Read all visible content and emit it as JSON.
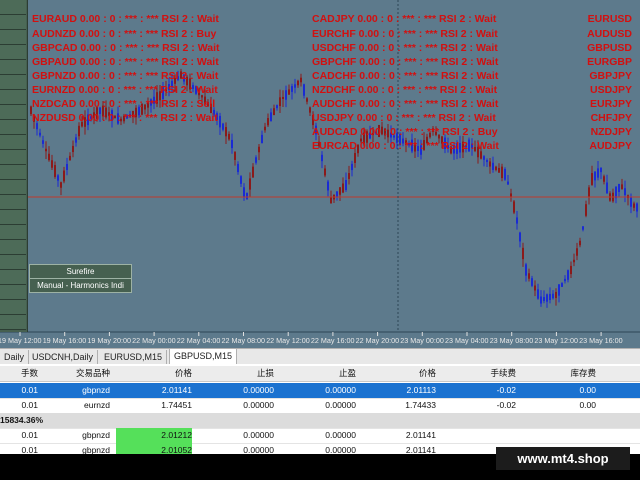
{
  "chart": {
    "bg_color": "#5d7a8c",
    "level_line_color": "#c0392b",
    "bull_color": "#1a2bd4",
    "bear_color": "#8b1a1a",
    "time_labels": [
      "19 May 12:00",
      "19 May 16:00",
      "19 May 20:00",
      "22 May 00:00",
      "22 May 04:00",
      "22 May 08:00",
      "22 May 12:00",
      "22 May 16:00",
      "22 May 20:00",
      "23 May 00:00",
      "23 May 04:00",
      "23 May 08:00",
      "23 May 12:00",
      "23 May 16:00"
    ]
  },
  "signals_left": [
    {
      "pair": "EURAUD",
      "text": "EURAUD  0.00 : 0 : *** : *** RSI 2 : Wait"
    },
    {
      "pair": "AUDNZD",
      "text": "AUDNZD  0.00 : 0 : *** : *** RSI 2 : Buy"
    },
    {
      "pair": "GBPCAD",
      "text": "GBPCAD  0.00 : 0 : *** : *** RSI 2 : Wait"
    },
    {
      "pair": "GBPAUD",
      "text": "GBPAUD  0.00 : 0 : *** : *** RSI 2 : Wait"
    },
    {
      "pair": "GBPNZD",
      "text": "GBPNZD  0.00 : 0 : *** : *** RSI 2 : Wait"
    },
    {
      "pair": "EURNZD",
      "text": "EURNZD  0.00 : 0 : *** : *** RSI 2 : Wait"
    },
    {
      "pair": "NZDCAD",
      "text": "NZDCAD  0.00 : 0 : *** : *** RSI 2 : Sell"
    },
    {
      "pair": "NZDUSD",
      "text": "NZDUSD  0.00 : 0 : *** : *** RSI 2 : Wait"
    }
  ],
  "signals_mid": [
    {
      "pair": "CADJPY",
      "text": "CADJPY  0.00 : 0 : *** : *** RSI 2 : Wait"
    },
    {
      "pair": "EURCHF",
      "text": "EURCHF  0.00 : 0 : *** : *** RSI 2 : Wait"
    },
    {
      "pair": "USDCHF",
      "text": "USDCHF  0.00 : 0 : *** : *** RSI 2 : Wait"
    },
    {
      "pair": "GBPCHF",
      "text": "GBPCHF  0.00 : 0 : *** : *** RSI 2 : Wait"
    },
    {
      "pair": "CADCHF",
      "text": "CADCHF  0.00 : 0 : *** : *** RSI 2 : Wait"
    },
    {
      "pair": "NZDCHF",
      "text": "NZDCHF  0.00 : 0 : *** : *** RSI 2 : Wait"
    },
    {
      "pair": "AUDCHF",
      "text": "AUDCHF  0.00 : 0 : *** : *** RSI 2 : Wait"
    },
    {
      "pair": "USDJPY",
      "text": "USDJPY  0.00 : 0 : *** : *** RSI 2 : Wait"
    },
    {
      "pair": "AUDCAD",
      "text": "AUDCAD  0.00 : 0 : *** : *** RSI 2 : Buy"
    },
    {
      "pair": "EURCAD",
      "text": "EURCAD  0.00 : 0 : *** : *** RSI 2 : Wait"
    }
  ],
  "signals_right": [
    "EURUSD",
    "AUDUSD",
    "GBPUSD",
    "EURGBP",
    "GBPJPY",
    "USDJPY",
    "EURJPY",
    "CHFJPY",
    "NZDJPY",
    "AUDJPY"
  ],
  "ea_buttons": [
    "Surefire",
    "Manual - Harmonics Indi"
  ],
  "tabs": [
    {
      "label": "Daily",
      "active": false
    },
    {
      "label": "USDCNH,Daily",
      "active": false
    },
    {
      "label": "EURUSD,M15",
      "active": false
    },
    {
      "label": "GBPUSD,M15",
      "active": true
    }
  ],
  "table": {
    "headers": [
      "手数",
      "交易品种",
      "价格",
      "止损",
      "止盈",
      "价格",
      "手续费",
      "库存费"
    ],
    "rows": [
      {
        "cells": [
          "0.01",
          "gbpnzd",
          "2.01141",
          "0.00000",
          "0.00000",
          "2.01113",
          "-0.02",
          "0.00"
        ],
        "selected": true
      },
      {
        "cells": [
          "0.01",
          "eurnzd",
          "1.74451",
          "0.00000",
          "0.00000",
          "1.74433",
          "-0.02",
          "0.00"
        ],
        "selected": false
      }
    ],
    "summary": "15834.36%",
    "pending": [
      {
        "cells": [
          "0.01",
          "gbpnzd",
          "2.01212",
          "0.00000",
          "0.00000",
          "2.01141"
        ]
      },
      {
        "cells": [
          "0.01",
          "gbpnzd",
          "2.01052",
          "0.00000",
          "0.00000",
          "2.01141"
        ]
      }
    ]
  },
  "watermark": "www.mt4.shop"
}
